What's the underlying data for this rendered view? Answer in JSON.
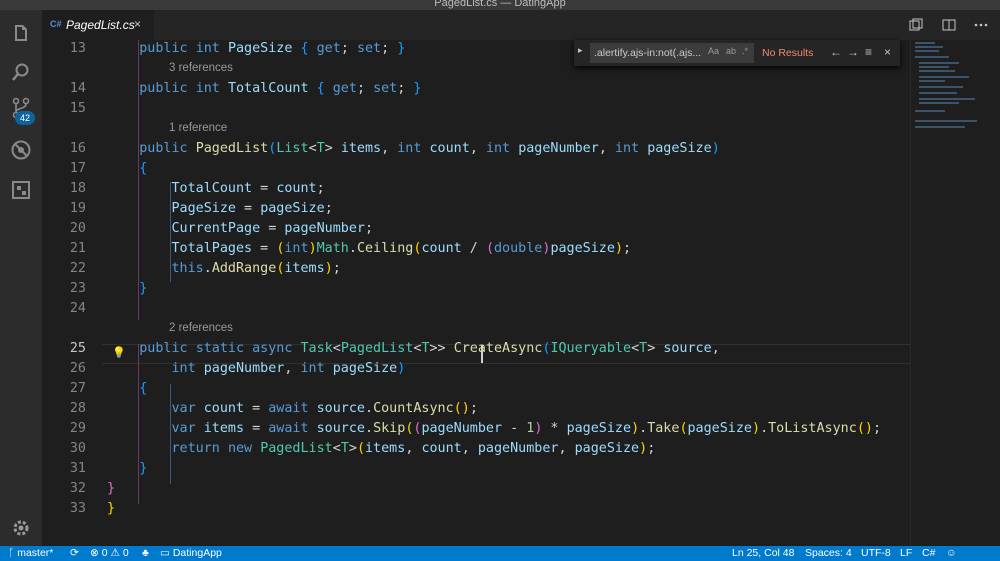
{
  "window": {
    "title": "PagedList.cs — DatingApp"
  },
  "activity_bar": {
    "items": [
      "files-icon",
      "search-icon",
      "source-control-icon",
      "debug-icon",
      "extensions-icon",
      "settings-gear-icon"
    ],
    "scm_badge": "42"
  },
  "tab": {
    "lang": "C#",
    "name": "PagedList.cs",
    "close": "×"
  },
  "find": {
    "expand": "▸",
    "query": ".alertify.ajs-in:not(.ajs...",
    "case_label": "Aa",
    "word_label": "ab",
    "regex_label": ".*",
    "result": "No Results",
    "prev": "←",
    "next": "→",
    "selection": "≡",
    "close": "×"
  },
  "editor": {
    "lines": [
      {
        "n": "13",
        "html": "    <span class=\"k\">public</span> <span class=\"k\">int</span> <span class=\"v\">PageSize</span> <span class=\"b3\">{</span> <span class=\"k\">get</span>; <span class=\"k\">set</span>; <span class=\"b3\">}</span>"
      },
      {
        "n": "14",
        "html": "    <span class=\"k\">public</span> <span class=\"k\">int</span> <span class=\"v\">TotalCount</span> <span class=\"b3\">{</span> <span class=\"k\">get</span>; <span class=\"k\">set</span>; <span class=\"b3\">}</span>"
      },
      {
        "n": "15",
        "html": ""
      },
      {
        "n": "16",
        "html": "    <span class=\"k\">public</span> <span class=\"f\">PagedList</span><span class=\"b3\">(</span><span class=\"t\">List</span>&lt;<span class=\"t\">T</span>&gt; <span class=\"v\">items</span>, <span class=\"k\">int</span> <span class=\"v\">count</span>, <span class=\"k\">int</span> <span class=\"v\">pageNumber</span>, <span class=\"k\">int</span> <span class=\"v\">pageSize</span><span class=\"b3\">)</span>"
      },
      {
        "n": "17",
        "html": "    <span class=\"b3\">{</span>"
      },
      {
        "n": "18",
        "html": "        <span class=\"v\">TotalCount</span> = <span class=\"v\">count</span>;"
      },
      {
        "n": "19",
        "html": "        <span class=\"v\">PageSize</span> = <span class=\"v\">pageSize</span>;"
      },
      {
        "n": "20",
        "html": "        <span class=\"v\">CurrentPage</span> = <span class=\"v\">pageNumber</span>;"
      },
      {
        "n": "21",
        "html": "        <span class=\"v\">TotalPages</span> = <span class=\"b1\">(</span><span class=\"k\">int</span><span class=\"b1\">)</span><span class=\"t\">Math</span>.<span class=\"f\">Ceiling</span><span class=\"b1\">(</span><span class=\"v\">count</span> / <span class=\"b2\">(</span><span class=\"k\">double</span><span class=\"b2\">)</span><span class=\"v\">pageSize</span><span class=\"b1\">)</span>;"
      },
      {
        "n": "22",
        "html": "        <span class=\"k\">this</span>.<span class=\"f\">AddRange</span><span class=\"b1\">(</span><span class=\"v\">items</span><span class=\"b1\">)</span>;"
      },
      {
        "n": "23",
        "html": "    <span class=\"b3\">}</span>"
      },
      {
        "n": "24",
        "html": ""
      },
      {
        "n": "25",
        "html": "    <span class=\"k\">public</span> <span class=\"k\">static</span> <span class=\"k\">async</span> <span class=\"t\">Task</span>&lt;<span class=\"t\">PagedList</span>&lt;<span class=\"t\">T</span>&gt;&gt; <span class=\"f\">CreateAsync</span><span class=\"b3\">(</span><span class=\"t\">IQueryable</span>&lt;<span class=\"t\">T</span>&gt; <span class=\"v\">source</span>,"
      },
      {
        "n": "26",
        "html": "        <span class=\"k\">int</span> <span class=\"v\">pageNumber</span>, <span class=\"k\">int</span> <span class=\"v\">pageSize</span><span class=\"b3\">)</span>"
      },
      {
        "n": "27",
        "html": "    <span class=\"b3\">{</span>"
      },
      {
        "n": "28",
        "html": "        <span class=\"k\">var</span> <span class=\"v\">count</span> = <span class=\"k\">await</span> <span class=\"v\">source</span>.<span class=\"f\">CountAsync</span><span class=\"b1\">()</span>;"
      },
      {
        "n": "29",
        "html": "        <span class=\"k\">var</span> <span class=\"v\">items</span> = <span class=\"k\">await</span> <span class=\"v\">source</span>.<span class=\"f\">Skip</span><span class=\"b1\">(</span><span class=\"b2\">(</span><span class=\"v\">pageNumber</span> - <span class=\"n\">1</span><span class=\"b2\">)</span> * <span class=\"v\">pageSize</span><span class=\"b1\">)</span>.<span class=\"f\">Take</span><span class=\"b1\">(</span><span class=\"v\">pageSize</span><span class=\"b1\">)</span>.<span class=\"f\">ToListAsync</span><span class=\"b1\">()</span>;"
      },
      {
        "n": "30",
        "html": "        <span class=\"k\">return</span> <span class=\"k\">new</span> <span class=\"t\">PagedList</span>&lt;<span class=\"t\">T</span>&gt;<span class=\"b1\">(</span><span class=\"v\">items</span>, <span class=\"v\">count</span>, <span class=\"v\">pageNumber</span>, <span class=\"v\">pageSize</span><span class=\"b1\">)</span>;"
      },
      {
        "n": "31",
        "html": "    <span class=\"b3\">}</span>"
      },
      {
        "n": "32",
        "html": "<span class=\"b2\">}</span>"
      },
      {
        "n": "33",
        "html": "<span class=\"b1\">}</span>"
      }
    ],
    "lenses": [
      {
        "after": "13",
        "text": "3 references"
      },
      {
        "after": "15",
        "text": "1 reference"
      },
      {
        "after": "24",
        "text": "2 references"
      }
    ],
    "current_line": "25"
  },
  "status": {
    "branch": "master*",
    "errors": "0",
    "warnings": "0",
    "project": "DatingApp",
    "position": "Ln 25, Col 48",
    "spaces": "Spaces: 4",
    "encoding": "UTF-8",
    "eol": "LF",
    "language": "C#"
  }
}
